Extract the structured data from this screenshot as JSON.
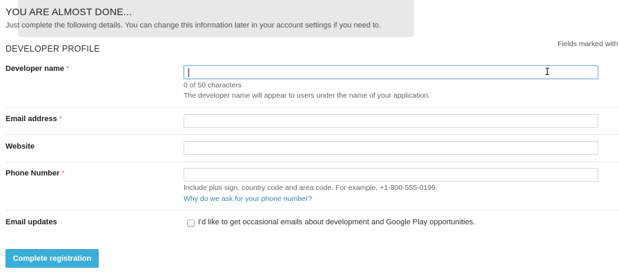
{
  "header": {
    "title": "YOU ARE ALMOST DONE...",
    "subtitle": "Just complete the following details. You can change this information later in your account settings if you need to."
  },
  "section": {
    "title": "DEVELOPER PROFILE",
    "fields_note": "Fields marked with"
  },
  "form": {
    "developer_name": {
      "label": "Developer name",
      "required_mark": "*",
      "value": "",
      "char_count": "0 of 50 characters",
      "help": "The developer name will appear to users under the name of your application."
    },
    "email": {
      "label": "Email address",
      "required_mark": "*",
      "value": ""
    },
    "website": {
      "label": "Website",
      "value": ""
    },
    "phone": {
      "label": "Phone Number",
      "required_mark": "*",
      "value": "",
      "help": "Include plus sign, country code and area code. For example, +1-800-555-0199.",
      "link": "Why do we ask for your phone number?"
    },
    "email_updates": {
      "label": "Email updates",
      "checked": false,
      "checkbox_label": "I'd like to get occasional emails about development and Google Play opportunities."
    }
  },
  "actions": {
    "complete_label": "Complete registration"
  },
  "colors": {
    "accent": "#3aaed8",
    "link": "#3b87b8",
    "required": "#d47a7a"
  }
}
